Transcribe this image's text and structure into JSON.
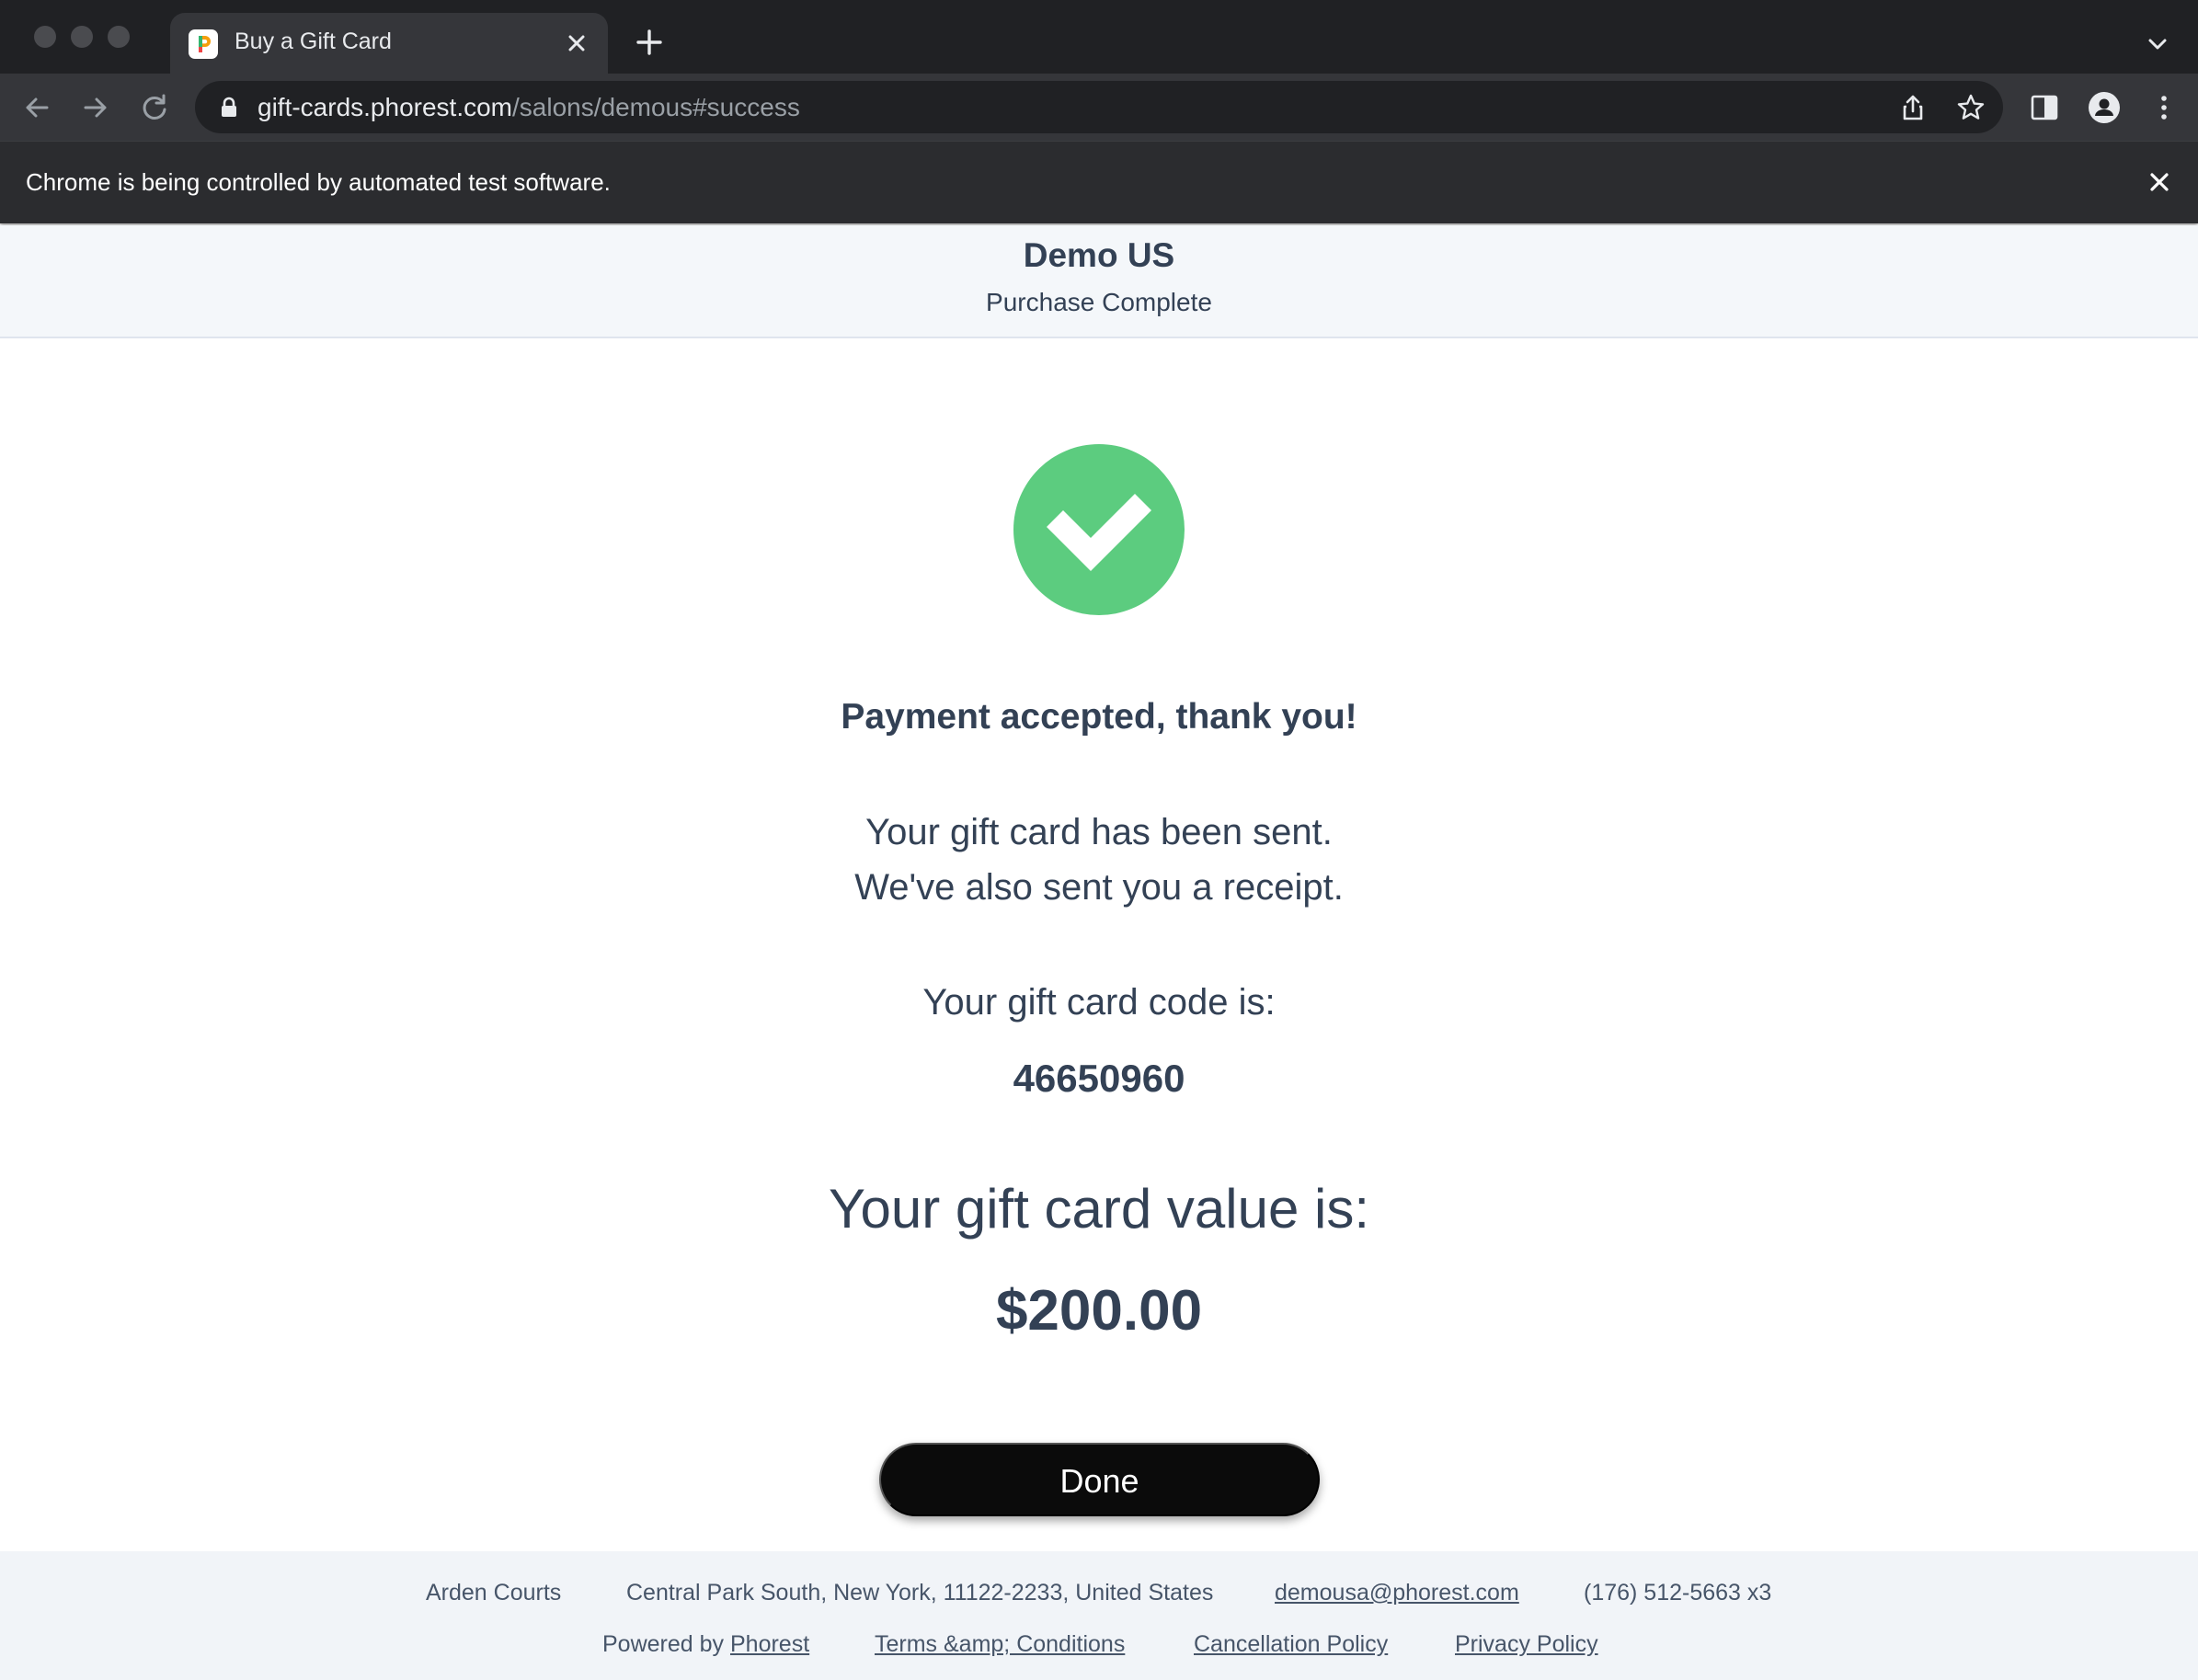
{
  "browser": {
    "tab": {
      "title": "Buy a Gift Card"
    },
    "address_bar": {
      "host": "gift-cards.phorest.com",
      "path": "/salons/demous#success"
    },
    "infobar": {
      "message": "Chrome is being controlled by automated test software."
    }
  },
  "header": {
    "salon_name": "Demo US",
    "status": "Purchase Complete"
  },
  "main": {
    "success_icon": "check-circle-icon",
    "accent_color": "#5ccc7f",
    "title": "Payment accepted, thank you!",
    "line1": "Your gift card has been sent.",
    "line2": "We've also sent you a receipt.",
    "code_label": "Your gift card code is:",
    "code": "46650960",
    "value_label": "Your gift card value is:",
    "value": "$200.00",
    "done_label": "Done"
  },
  "footer": {
    "location": "Arden Courts",
    "address": "Central Park South, New York, 11122-2233, United States",
    "email": "demousa@phorest.com",
    "phone": "(176) 512-5663 x3",
    "powered_by_prefix": "Powered by",
    "powered_by_link": "Phorest",
    "terms": "Terms &amp; Conditions",
    "cancellation": "Cancellation Policy",
    "privacy": "Privacy Policy"
  }
}
